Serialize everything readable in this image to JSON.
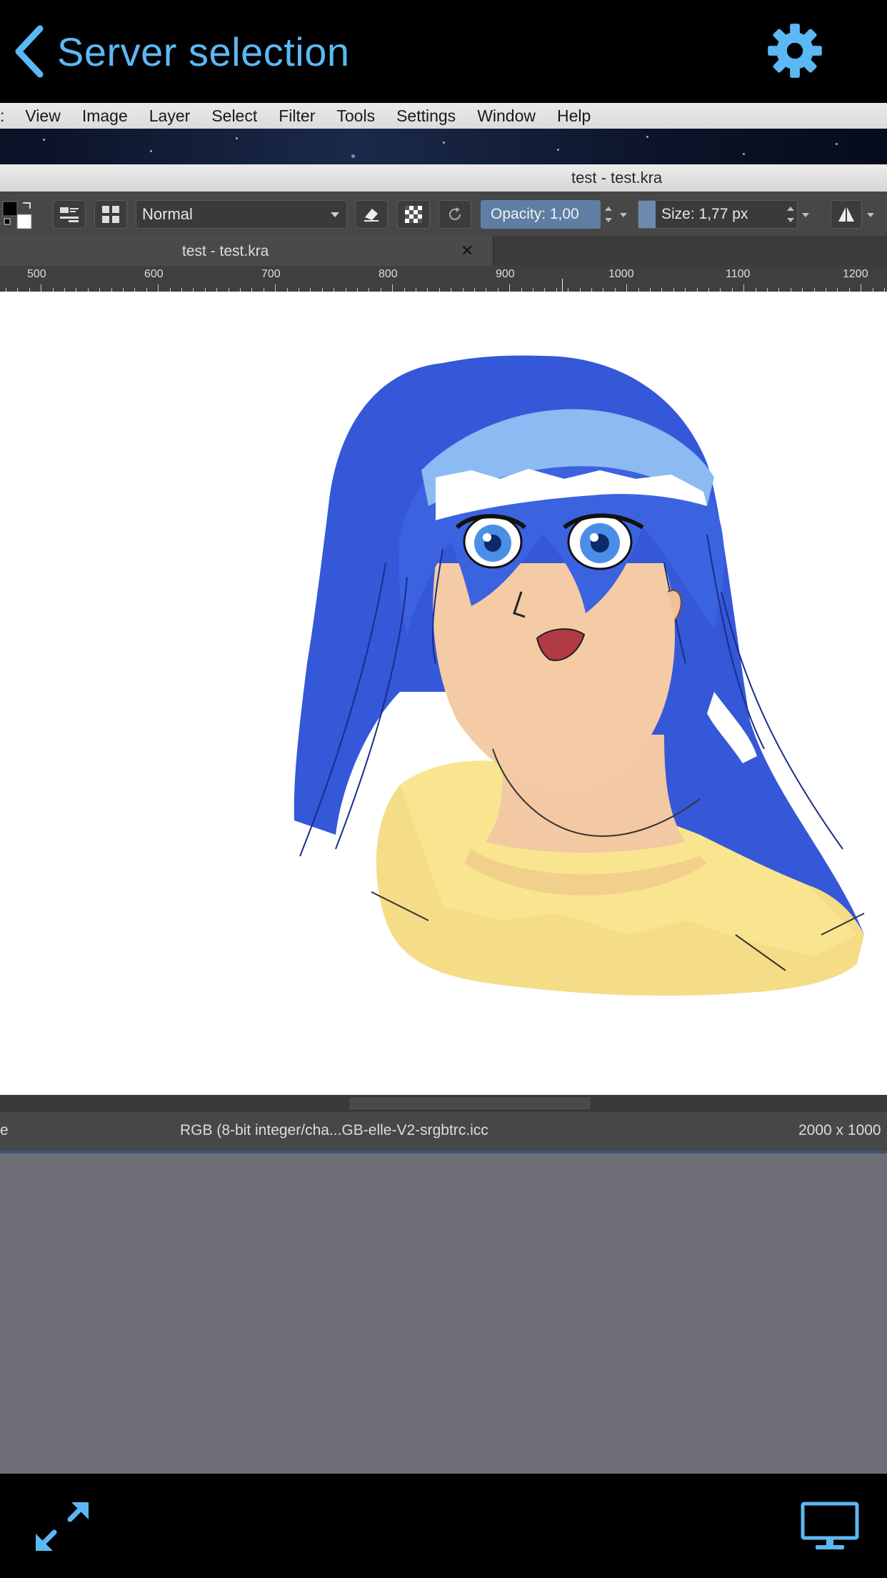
{
  "header": {
    "back_label": "Server selection",
    "settings_icon": "gear-icon",
    "accent_color": "#5cb8f4"
  },
  "remote": {
    "menu": [
      ":",
      "View",
      "Image",
      "Layer",
      "Select",
      "Filter",
      "Tools",
      "Settings",
      "Window",
      "Help"
    ],
    "window_title": "test - test.kra",
    "toolbar": {
      "blend_mode": "Normal",
      "opacity": "Opacity:  1,00",
      "size": "Size:  1,77 px"
    },
    "document_tab": {
      "label": "test - test.kra",
      "close": "✕"
    },
    "ruler_labels": [
      "500",
      "600",
      "700",
      "800",
      "900",
      "1000",
      "1100",
      "1200"
    ],
    "status": {
      "left": "e",
      "color_profile": "RGB (8-bit integer/cha...GB-elle-V2-srgbtrc.icc",
      "dimensions": "2000 x 1000"
    }
  },
  "footer": {
    "left_icon": "fullscreen-toggle-icon",
    "right_icon": "monitor-icon"
  }
}
